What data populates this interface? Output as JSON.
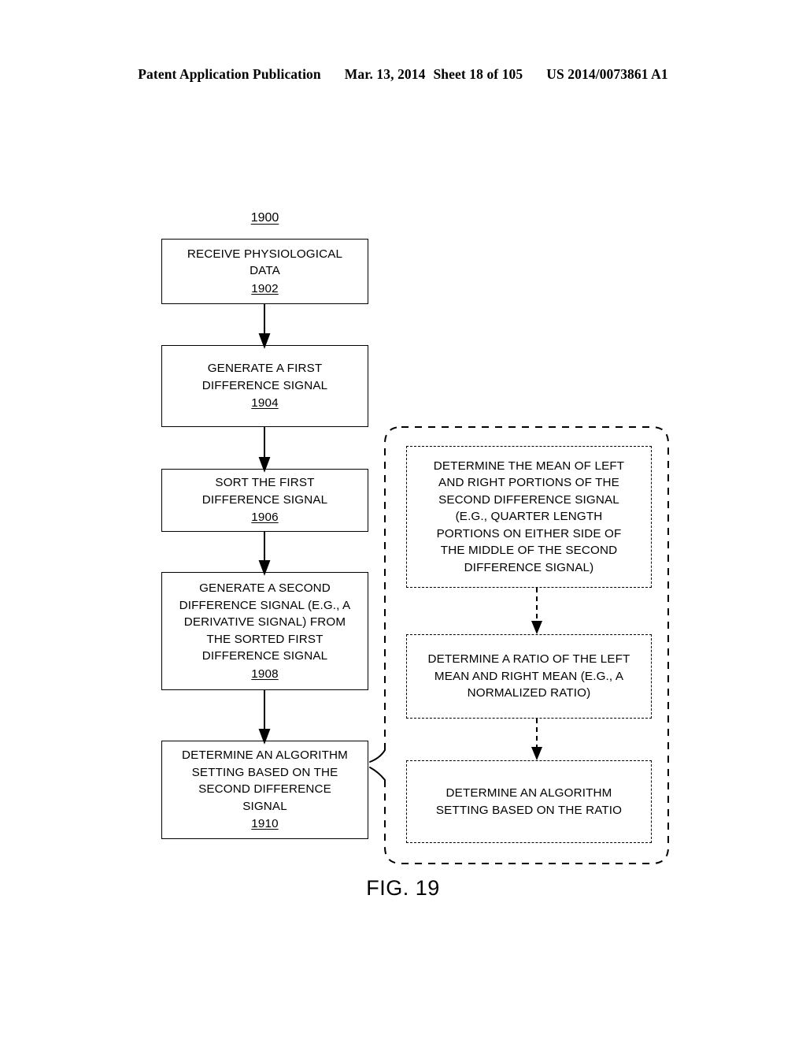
{
  "header": {
    "publication": "Patent Application Publication",
    "date": "Mar. 13, 2014",
    "sheet": "Sheet 18 of 105",
    "docnumber": "US 2014/0073861 A1"
  },
  "figure": {
    "caption": "FIG. 19",
    "diagram_ref": "1900"
  },
  "flow_steps": [
    {
      "ref": "1902",
      "lines": [
        "RECEIVE PHYSIOLOGICAL",
        "DATA"
      ]
    },
    {
      "ref": "1904",
      "lines": [
        "GENERATE A FIRST",
        "DIFFERENCE SIGNAL"
      ]
    },
    {
      "ref": "1906",
      "lines": [
        "SORT THE FIRST",
        "DIFFERENCE SIGNAL"
      ]
    },
    {
      "ref": "1908",
      "lines": [
        "GENERATE A SECOND",
        "DIFFERENCE SIGNAL (E.G., A",
        "DERIVATIVE SIGNAL) FROM",
        "THE SORTED FIRST",
        "DIFFERENCE SIGNAL"
      ]
    },
    {
      "ref": "1910",
      "lines": [
        "DETERMINE AN ALGORITHM",
        "SETTING BASED ON THE",
        "SECOND DIFFERENCE",
        "SIGNAL"
      ]
    }
  ],
  "detail_steps": [
    {
      "lines": [
        "DETERMINE THE MEAN OF LEFT",
        "AND RIGHT PORTIONS OF THE",
        "SECOND DIFFERENCE SIGNAL",
        "(E.G., QUARTER LENGTH",
        "PORTIONS ON EITHER SIDE OF",
        "THE MIDDLE OF THE SECOND",
        "DIFFERENCE SIGNAL)"
      ]
    },
    {
      "lines": [
        "DETERMINE A RATIO OF THE LEFT",
        "MEAN AND RIGHT MEAN (E.G., A",
        "NORMALIZED RATIO)"
      ]
    },
    {
      "lines": [
        "DETERMINE AN ALGORITHM",
        "SETTING BASED ON THE RATIO"
      ]
    }
  ],
  "colors": {
    "ink": "#000000",
    "paper": "#ffffff"
  }
}
